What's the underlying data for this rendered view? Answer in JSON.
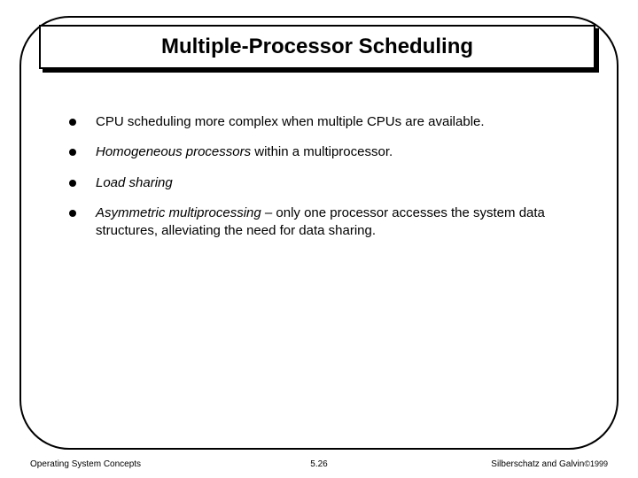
{
  "title": "Multiple-Processor Scheduling",
  "bullets": {
    "b1": "CPU scheduling more complex when multiple CPUs are available.",
    "b2_italic": "Homogeneous processors",
    "b2_rest": " within a multiprocessor.",
    "b3_italic": "Load sharing",
    "b4_italic": "Asymmetric multiprocessing",
    "b4_rest": " – only one processor accesses the system data structures, alleviating the need for data sharing."
  },
  "footer": {
    "left": "Operating System Concepts",
    "center": "5.26",
    "right_name": "Silberschatz and Galvin",
    "right_copy": "©1999"
  }
}
